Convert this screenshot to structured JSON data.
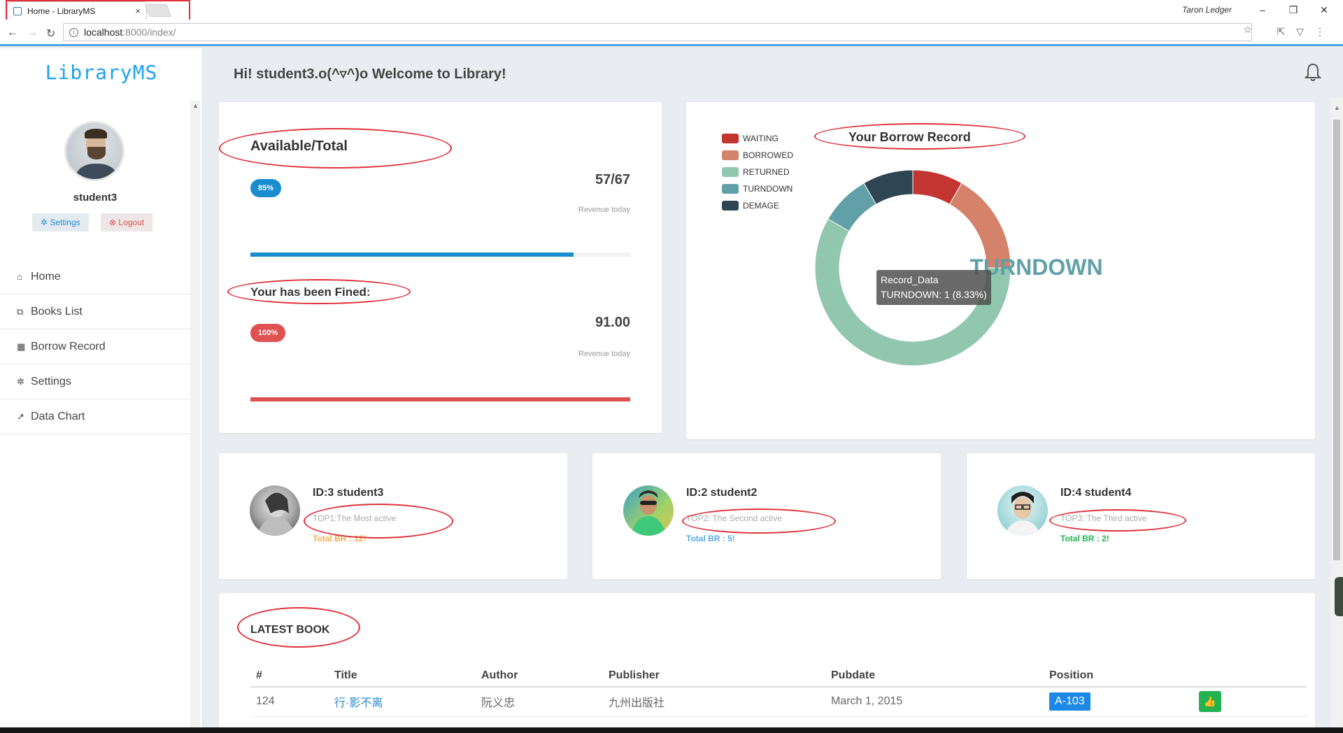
{
  "browser": {
    "tab_title": "Home - LibraryMS",
    "tab_close": "×",
    "profile_name": "Taron Ledger",
    "minimize": "–",
    "restore": "❐",
    "close": "✕",
    "back": "←",
    "forward": "→",
    "reload": "↻",
    "url_host": "localhost",
    "url_path": ":8000/index/"
  },
  "sidebar": {
    "logo": "LibraryMS",
    "username": "student3",
    "settings_button": "Settings",
    "logout_button": "Logout",
    "items": [
      {
        "icon": "home-icon",
        "glyph": "⌂",
        "label": "Home"
      },
      {
        "icon": "books-icon",
        "glyph": "⧉",
        "label": "Books List"
      },
      {
        "icon": "table-icon",
        "glyph": "▦",
        "label": "Borrow Record"
      },
      {
        "icon": "gear-icon",
        "glyph": "✲",
        "label": "Settings"
      },
      {
        "icon": "line-chart-icon",
        "glyph": "↗",
        "label": "Data Chart"
      }
    ]
  },
  "header": {
    "welcome": "Hi! student3.o(^▿^)o Welcome to Library!"
  },
  "stats": {
    "available_title": "Available/Total",
    "available_badge": "85%",
    "available_value": "57/67",
    "available_caption": "Revenue today",
    "available_fraction": 0.85,
    "available_color": "#1a8cd0",
    "fined_title": "Your has been Fined:",
    "fined_badge": "100%",
    "fined_value": "91.00",
    "fined_caption": "Revenue today",
    "fined_fraction": 1.0,
    "fined_color": "#e05252"
  },
  "chart_data": {
    "type": "pie",
    "title": "Your Borrow Record",
    "categories": [
      "WAITING",
      "BORROWED",
      "RETURNED",
      "TURNDOWN",
      "DEMAGE"
    ],
    "values": [
      1,
      2,
      7,
      1,
      1
    ],
    "colors": [
      "#c23531",
      "#d4826a",
      "#91c7ae",
      "#61a0a8",
      "#2f4554"
    ],
    "center_label": "TURNDOWN",
    "tooltip_series": "Record_Data",
    "tooltip_text": "TURNDOWN: 1 (8.33%)",
    "legend_position": "top-left"
  },
  "top_users": [
    {
      "name": "ID:3 student3",
      "rank": "TOP1:The Most active",
      "br": "Total BR : 12!",
      "br_color": "#f0ad4e"
    },
    {
      "name": "ID:2 student2",
      "rank": "TOP2: The Second active",
      "br": "Total BR : 5!",
      "br_color": "#5aa9e6"
    },
    {
      "name": "ID:4 student4",
      "rank": "TOP3: The Third active",
      "br": "Total BR : 2!",
      "br_color": "#21b34f"
    }
  ],
  "latest": {
    "title": "LATEST BOOK",
    "headers": [
      "#",
      "Title",
      "Author",
      "Publisher",
      "Pubdate",
      "Position",
      ""
    ],
    "rows": [
      {
        "id": "124",
        "title": "行·影不离",
        "author": "阮义忠",
        "publisher": "九州出版社",
        "pubdate": "March 1, 2015",
        "position": "A-103"
      }
    ]
  }
}
